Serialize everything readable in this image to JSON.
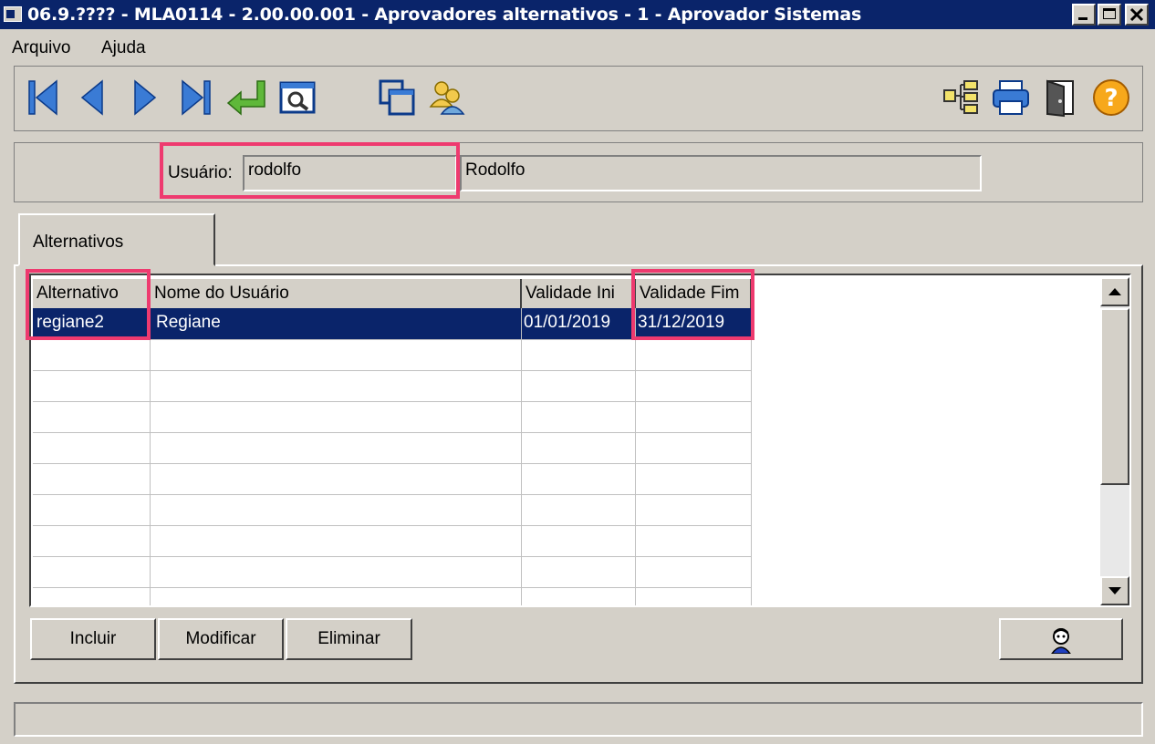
{
  "window": {
    "title": "06.9.???? - MLA0114 - 2.00.00.001 - Aprovadores alternativos - 1 - Aprovador Sistemas"
  },
  "menu": {
    "items": [
      "Arquivo",
      "Ajuda"
    ]
  },
  "toolbar": {
    "left_icons": [
      "first-record-icon",
      "previous-record-icon",
      "next-record-icon",
      "last-record-icon",
      "return-icon",
      "search-icon",
      "copy-icon",
      "users-icon"
    ],
    "right_icons": [
      "tree-icon",
      "print-icon",
      "exit-door-icon",
      "help-icon"
    ]
  },
  "header": {
    "user_label": "Usuário:",
    "user_code": "rodolfo",
    "user_name": "Rodolfo"
  },
  "tabs": [
    {
      "label": "Alternativos"
    }
  ],
  "grid": {
    "columns": [
      "Alternativo",
      "Nome do Usuário",
      "Validade Ini",
      "Validade Fim"
    ],
    "rows": [
      {
        "alternativo": "regiane2",
        "nome": "Regiane",
        "validade_ini": "01/01/2019",
        "validade_fim": "31/12/2019"
      }
    ]
  },
  "buttons": {
    "incluir": "Incluir",
    "modificar": "Modificar",
    "eliminar": "Eliminar"
  },
  "colors": {
    "titlebar": "#0a246a",
    "highlight": "#ee3a6f",
    "selection": "#0a246a"
  }
}
